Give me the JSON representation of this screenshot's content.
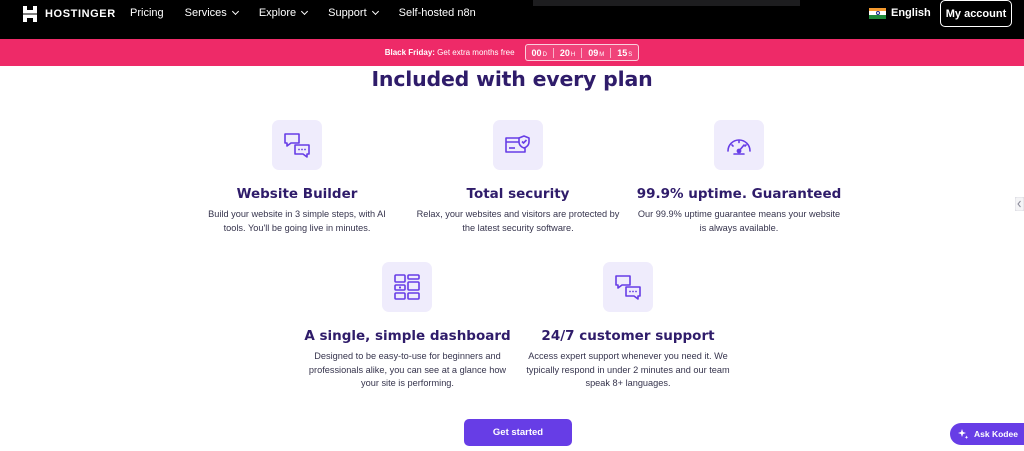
{
  "nav": {
    "logo_text": "HOSTINGER",
    "items": [
      {
        "label": "Pricing",
        "dropdown": false
      },
      {
        "label": "Services",
        "dropdown": true
      },
      {
        "label": "Explore",
        "dropdown": true
      },
      {
        "label": "Support",
        "dropdown": true
      },
      {
        "label": "Self-hosted n8n",
        "dropdown": false
      }
    ],
    "language": "English",
    "account_button": "My account"
  },
  "promo": {
    "label": "Black Friday:",
    "text": "Get extra months free",
    "countdown": {
      "days": "00",
      "days_unit": "D",
      "hours": "20",
      "hours_unit": "H",
      "minutes": "09",
      "minutes_unit": "M",
      "seconds": "15",
      "seconds_unit": "S"
    }
  },
  "main": {
    "heading": "Included with every plan",
    "features": [
      {
        "icon": "chat-bubbles-icon",
        "title": "Website Builder",
        "description": "Build your website in 3 simple steps, with AI tools. You'll be going live in minutes."
      },
      {
        "icon": "secure-card-icon",
        "title": "Total security",
        "description": "Relax, your websites and visitors are protected by the latest security software."
      },
      {
        "icon": "speedometer-icon",
        "title": "99.9% uptime. Guaranteed",
        "description": "Our 99.9% uptime guarantee means your website is always available."
      },
      {
        "icon": "dashboard-grid-icon",
        "title": "A single, simple dashboard",
        "description": "Designed to be easy-to-use for beginners and professionals alike, you can see at a glance how your site is performing."
      },
      {
        "icon": "chat-bubbles-icon",
        "title": "24/7 customer support",
        "description": "Access expert support whenever you need it. We typically respond in under 2 minutes and our team speak 8+ languages."
      }
    ],
    "cta_label": "Get started"
  },
  "chat_widget": {
    "label": "Ask Kodee"
  },
  "colors": {
    "brand_purple": "#673de6",
    "promo_pink": "#ee2a68",
    "heading": "#2f1c6a",
    "icon_bg": "#efecfc"
  }
}
